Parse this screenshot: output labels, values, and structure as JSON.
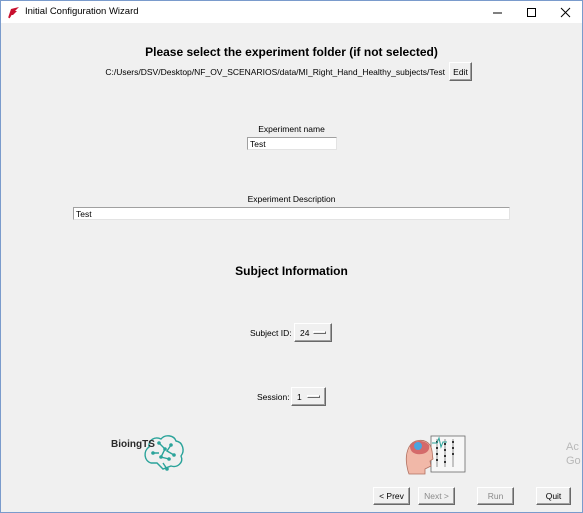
{
  "window": {
    "title": "Initial Configuration Wizard",
    "controls": {
      "minimize_icon": "minimize-icon",
      "maximize_icon": "maximize-icon",
      "close_icon": "close-icon"
    }
  },
  "folder": {
    "heading": "Please select the experiment folder (if not selected)",
    "path": "C:/Users/DSV/Desktop/NF_OV_SCENARIOS/data/MI_Right_Hand_Healthy_subjects/Test",
    "edit_label": "Edit"
  },
  "experiment": {
    "name_label": "Experiment name",
    "name_value": "Test",
    "description_label": "Experiment Description",
    "description_value": "Test"
  },
  "subject": {
    "heading": "Subject Information",
    "id_label": "Subject ID:",
    "id_value": "24",
    "session_label": "Session:",
    "session_value": "1"
  },
  "branding": {
    "logo_text": "BioingTS",
    "logo_color": "#2aa39a"
  },
  "navigation": {
    "prev_label": "< Prev",
    "next_label": "Next >",
    "run_label": "Run",
    "quit_label": "Quit"
  },
  "watermark": {
    "line1": "Ac",
    "line2": "Go"
  }
}
